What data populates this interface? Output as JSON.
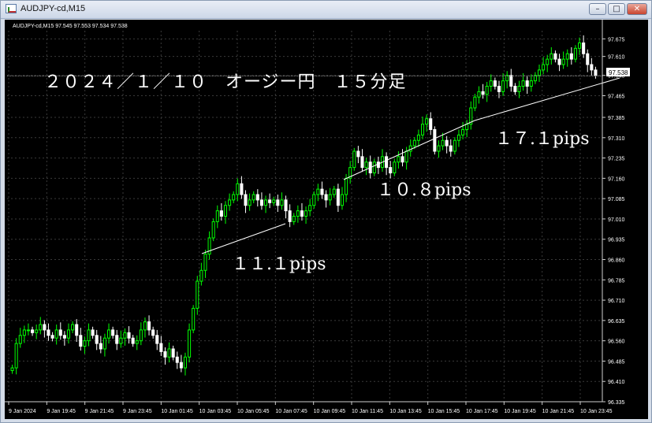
{
  "window": {
    "title": "AUDJPY-cd,M15",
    "buttons": {
      "minimize": "–",
      "maximize": "□",
      "close": "✕"
    }
  },
  "chart_header": "AUDJPY-cd,M15  97.545 97.553 97.534 97.538",
  "price_label": "97.538",
  "annotations": {
    "title": "２０２４／１／１０　オージー円　１５分足",
    "move1": "１１.１pips",
    "move2": "１０.８pips",
    "move3": "１７.１pips"
  },
  "colors": {
    "background": "#000000",
    "bull": "#00ff00",
    "bear": "#ffffff",
    "grid": "#3a3a3a",
    "text": "#ffffff",
    "trendline": "#ffffff"
  },
  "chart_data": {
    "type": "candlestick",
    "symbol": "AUDJPY-cd",
    "timeframe": "M15",
    "ylim": [
      96.335,
      97.705
    ],
    "yticks": [
      "97.675",
      "97.610",
      "97.540",
      "97.465",
      "97.385",
      "97.310",
      "97.235",
      "97.160",
      "97.085",
      "97.010",
      "96.935",
      "96.860",
      "96.785",
      "96.710",
      "96.635",
      "96.560",
      "96.485",
      "96.410",
      "96.335"
    ],
    "xticks": [
      "9 Jan 2024",
      "9 Jan 19:45",
      "9 Jan 21:45",
      "9 Jan 23:45",
      "10 Jan 01:45",
      "10 Jan 03:45",
      "10 Jan 05:45",
      "10 Jan 07:45",
      "10 Jan 09:45",
      "10 Jan 11:45",
      "10 Jan 13:45",
      "10 Jan 15:45",
      "10 Jan 17:45",
      "10 Jan 19:45",
      "10 Jan 21:45",
      "10 Jan 23:45"
    ],
    "current_price": 97.538,
    "ohlc_header": {
      "open": 97.545,
      "high": 97.553,
      "low": 97.534,
      "close": 97.538
    },
    "key_levels": [
      {
        "label": "segment1",
        "points": [
          96.56,
          96.48,
          96.46,
          96.87,
          97.02,
          97.05,
          97.06,
          97.02
        ]
      },
      {
        "label": "segment2",
        "points": [
          97.05,
          97.12,
          97.2,
          97.24,
          97.18,
          97.26
        ]
      },
      {
        "label": "segment3",
        "points": [
          97.3,
          97.42,
          97.46,
          97.5,
          97.56,
          97.64,
          97.58,
          97.54
        ]
      }
    ],
    "closes": [
      96.46,
      96.55,
      96.58,
      96.6,
      96.6,
      96.59,
      96.6,
      96.62,
      96.6,
      96.58,
      96.57,
      96.6,
      96.58,
      96.57,
      96.6,
      96.62,
      96.58,
      96.54,
      96.56,
      96.6,
      96.58,
      96.55,
      96.53,
      96.57,
      96.6,
      96.58,
      96.55,
      96.57,
      96.59,
      96.57,
      96.55,
      96.56,
      96.6,
      96.63,
      96.6,
      96.58,
      96.55,
      96.52,
      96.5,
      96.53,
      96.5,
      96.48,
      96.46,
      96.5,
      96.6,
      96.68,
      96.78,
      96.82,
      96.88,
      96.94,
      97.0,
      97.04,
      97.02,
      97.06,
      97.08,
      97.1,
      97.14,
      97.1,
      97.06,
      97.08,
      97.1,
      97.08,
      97.06,
      97.08,
      97.07,
      97.08,
      97.06,
      97.08,
      97.04,
      97.0,
      97.02,
      97.04,
      97.02,
      97.04,
      97.06,
      97.1,
      97.12,
      97.1,
      97.08,
      97.1,
      97.12,
      97.06,
      97.1,
      97.16,
      97.2,
      97.26,
      97.24,
      97.2,
      97.22,
      97.18,
      97.22,
      97.2,
      97.24,
      97.2,
      97.18,
      97.22,
      97.24,
      97.22,
      97.26,
      97.28,
      97.3,
      97.32,
      97.36,
      97.38,
      97.34,
      97.26,
      97.28,
      97.3,
      97.28,
      97.26,
      97.3,
      97.32,
      97.34,
      97.36,
      97.42,
      97.46,
      97.48,
      97.47,
      97.5,
      97.52,
      97.5,
      97.48,
      97.52,
      97.54,
      97.5,
      97.48,
      97.5,
      97.52,
      97.5,
      97.52,
      97.54,
      97.56,
      97.58,
      97.6,
      97.62,
      97.6,
      97.58,
      97.6,
      97.62,
      97.6,
      97.64,
      97.66,
      97.62,
      97.58,
      97.56,
      97.54
    ]
  }
}
